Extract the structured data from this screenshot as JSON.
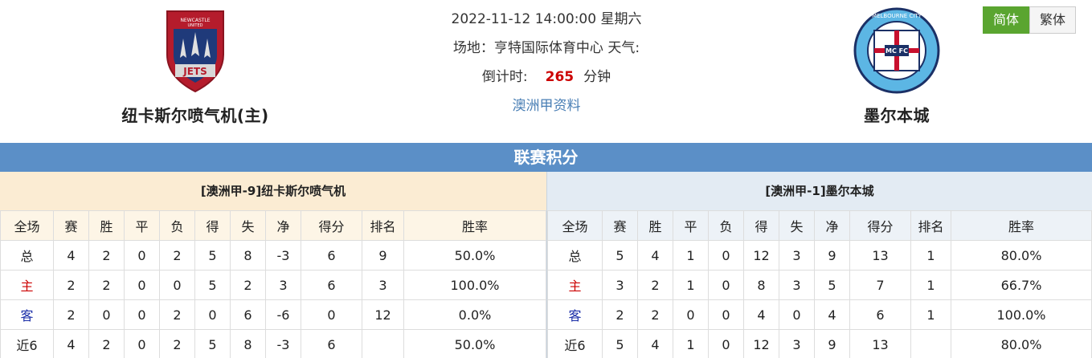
{
  "match": {
    "datetime": "2022-11-12 14:00:00",
    "weekday": "星期六",
    "venue_label": "场地：",
    "venue": "亨特国际体育中心",
    "weather_label": "天气:",
    "countdown_label": "倒计时:",
    "countdown_value": "265",
    "countdown_unit": "分钟",
    "league_link": "澳洲甲资料"
  },
  "home_team": {
    "name": "纽卡斯尔喷气机(主)",
    "logo_icon": "newcastle-jets-crest-icon"
  },
  "away_team": {
    "name": "墨尔本城",
    "logo_icon": "melbourne-city-crest-icon"
  },
  "language": {
    "simplified": "简体",
    "traditional": "繁体"
  },
  "section_title": "联赛积分",
  "columns": [
    "全场",
    "赛",
    "胜",
    "平",
    "负",
    "得",
    "失",
    "净",
    "得分",
    "排名",
    "胜率"
  ],
  "home_standings": {
    "title": "[澳洲甲-9]纽卡斯尔喷气机",
    "rows": [
      [
        "总",
        "4",
        "2",
        "0",
        "2",
        "5",
        "8",
        "-3",
        "6",
        "9",
        "50.0%"
      ],
      [
        "主",
        "2",
        "2",
        "0",
        "0",
        "5",
        "2",
        "3",
        "6",
        "3",
        "100.0%"
      ],
      [
        "客",
        "2",
        "0",
        "0",
        "2",
        "0",
        "6",
        "-6",
        "0",
        "12",
        "0.0%"
      ],
      [
        "近6",
        "4",
        "2",
        "0",
        "2",
        "5",
        "8",
        "-3",
        "6",
        "",
        "50.0%"
      ]
    ]
  },
  "away_standings": {
    "title": "[澳洲甲-1]墨尔本城",
    "rows": [
      [
        "总",
        "5",
        "4",
        "1",
        "0",
        "12",
        "3",
        "9",
        "13",
        "1",
        "80.0%"
      ],
      [
        "主",
        "3",
        "2",
        "1",
        "0",
        "8",
        "3",
        "5",
        "7",
        "1",
        "66.7%"
      ],
      [
        "客",
        "2",
        "2",
        "0",
        "0",
        "4",
        "0",
        "4",
        "6",
        "1",
        "100.0%"
      ],
      [
        "近6",
        "5",
        "4",
        "1",
        "0",
        "12",
        "3",
        "9",
        "13",
        "",
        "80.0%"
      ]
    ]
  },
  "colors": {
    "accent_blue": "#5b8fc7",
    "home_red": "#cc0000",
    "away_blue": "#1a2ea8",
    "lang_green": "#5aa530"
  }
}
